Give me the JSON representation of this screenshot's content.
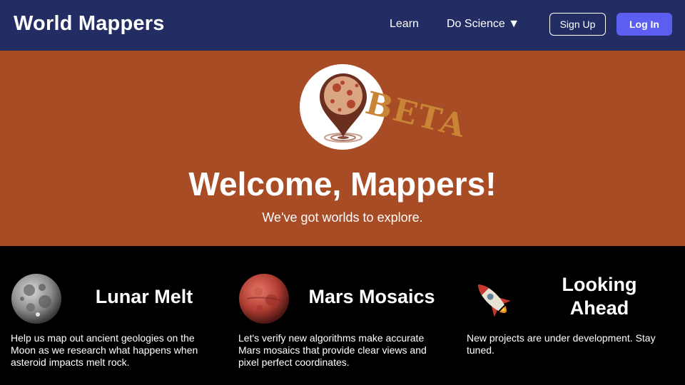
{
  "navbar": {
    "brand": "World Mappers",
    "links": {
      "learn": "Learn",
      "do_science": "Do Science ▼"
    },
    "buttons": {
      "sign_up": "Sign Up",
      "log_in": "Log In"
    }
  },
  "hero": {
    "logo_badge": "BETA",
    "title": "Welcome, Mappers!",
    "subtitle": "We've got worlds to explore."
  },
  "cards": [
    {
      "title": "Lunar Melt",
      "icon": "moon-icon",
      "text": "Help us map out ancient geologies on the Moon as we research what happens when asteroid impacts melt rock."
    },
    {
      "title": "Mars Mosaics",
      "icon": "mars-icon",
      "text": "Let's verify new algorithms make accurate Mars mosaics that provide clear views and pixel perfect coordinates."
    },
    {
      "title": "Looking Ahead",
      "icon": "rocket-icon",
      "text": "New projects are under development. Stay tuned."
    }
  ],
  "colors": {
    "navbar": "#232d63",
    "hero": "#a84c26",
    "login_button": "#5b5ef0",
    "beta_text": "#c98535"
  }
}
